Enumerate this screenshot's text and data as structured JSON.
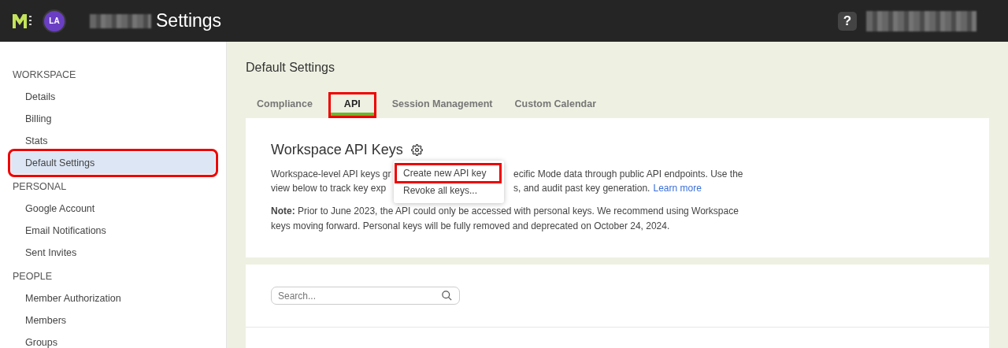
{
  "header": {
    "avatar": "LA",
    "title": "Settings",
    "help": "?"
  },
  "sidebar": {
    "sections": [
      {
        "heading": "WORKSPACE",
        "items": [
          {
            "label": "Details",
            "selected": false,
            "highlighted": false
          },
          {
            "label": "Billing",
            "selected": false,
            "highlighted": false
          },
          {
            "label": "Stats",
            "selected": false,
            "highlighted": false
          },
          {
            "label": "Default Settings",
            "selected": true,
            "highlighted": true
          }
        ]
      },
      {
        "heading": "PERSONAL",
        "items": [
          {
            "label": "Google Account",
            "selected": false,
            "highlighted": false
          },
          {
            "label": "Email Notifications",
            "selected": false,
            "highlighted": false
          },
          {
            "label": "Sent Invites",
            "selected": false,
            "highlighted": false
          }
        ]
      },
      {
        "heading": "PEOPLE",
        "items": [
          {
            "label": "Member Authorization",
            "selected": false,
            "highlighted": false
          },
          {
            "label": "Members",
            "selected": false,
            "highlighted": false
          },
          {
            "label": "Groups",
            "selected": false,
            "highlighted": false
          }
        ]
      }
    ]
  },
  "page_title": "Default Settings",
  "tabs": [
    {
      "label": "Compliance",
      "selected": false,
      "highlighted": false
    },
    {
      "label": "API",
      "selected": true,
      "highlighted": true
    },
    {
      "label": "Session Management",
      "selected": false,
      "highlighted": false
    },
    {
      "label": "Custom Calendar",
      "selected": false,
      "highlighted": false
    }
  ],
  "api_card": {
    "title": "Workspace API Keys",
    "description_lines": [
      {
        "before": "Workspace-level API keys gr",
        "after": "ecific Mode data through public API endpoints. Use the"
      },
      {
        "before": "view below to track key exp",
        "after": "s, and audit past key generation.",
        "link": "Learn more"
      }
    ],
    "note": "**Note:** Prior to June 2023, the API could only be accessed with personal keys. We recommend using Workspace keys moving forward. Personal keys will be fully removed and deprecated on October 24, 2024.",
    "menu": [
      {
        "label": "Create new API key",
        "highlighted": true
      },
      {
        "label": "Revoke all keys...",
        "highlighted": false
      }
    ]
  },
  "search": {
    "placeholder": "Search..."
  }
}
